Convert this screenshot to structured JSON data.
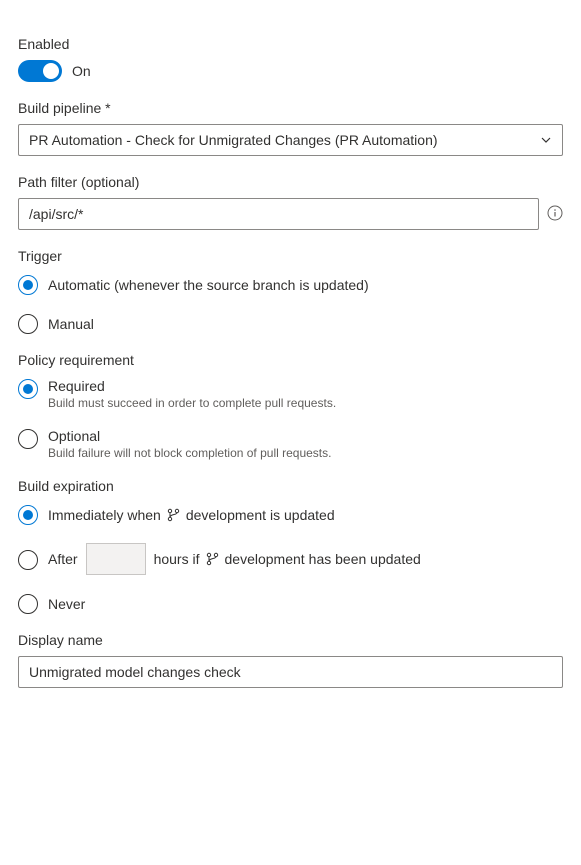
{
  "enabled": {
    "label": "Enabled",
    "state_label": "On"
  },
  "build_pipeline": {
    "label": "Build pipeline *",
    "value": "PR Automation - Check for Unmigrated Changes (PR Automation)"
  },
  "path_filter": {
    "label": "Path filter (optional)",
    "value": "/api/src/*"
  },
  "trigger": {
    "label": "Trigger",
    "options": {
      "automatic": "Automatic (whenever the source branch is updated)",
      "manual": "Manual"
    }
  },
  "policy_requirement": {
    "label": "Policy requirement",
    "options": {
      "required": {
        "label": "Required",
        "sublabel": "Build must succeed in order to complete pull requests."
      },
      "optional": {
        "label": "Optional",
        "sublabel": "Build failure will not block completion of pull requests."
      }
    }
  },
  "build_expiration": {
    "label": "Build expiration",
    "options": {
      "immediately": {
        "prefix": "Immediately when",
        "branch": "development",
        "suffix": "is updated"
      },
      "after": {
        "prefix": "After",
        "hours_value": "",
        "middle": "hours if",
        "branch": "development",
        "suffix": "has been updated"
      },
      "never": "Never"
    }
  },
  "display_name": {
    "label": "Display name",
    "value": "Unmigrated model changes check"
  }
}
